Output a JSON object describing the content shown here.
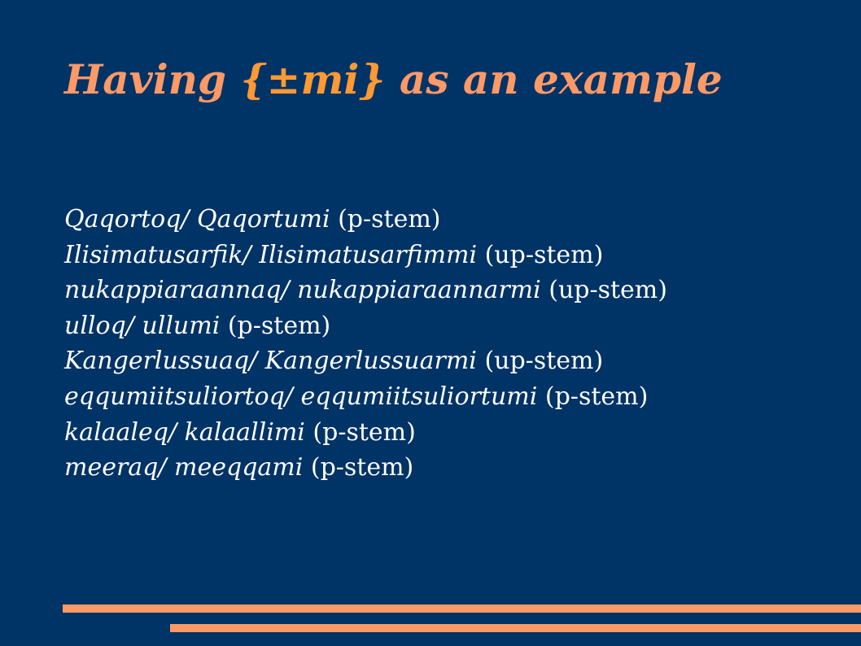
{
  "slide": {
    "title": {
      "before": "Having ",
      "highlight": "{±mi}",
      "after": " as an example"
    },
    "lines": [
      {
        "example": "Qaqortoq/ Qaqortumi",
        "stem": " (p-stem)"
      },
      {
        "example": "Ilisimatusarfik/ Ilisimatusarfimmi",
        "stem": " (up-stem)"
      },
      {
        "example": "nukappiaraannaq/ nukappiaraannarmi",
        "stem": " (up-stem)"
      },
      {
        "example": "ulloq/ ullumi",
        "stem": " (p-stem)"
      },
      {
        "example": "Kangerlussuaq/ Kangerlussuarmi",
        "stem": " (up-stem)"
      },
      {
        "example": "eqqumiitsuliortoq/ eqqumiitsuliortumi",
        "stem": " (p-stem)"
      },
      {
        "example": "kalaaleq/ kalaallimi",
        "stem": " (p-stem)"
      },
      {
        "example": "meeraq/ meeqqami",
        "stem": " (p-stem)"
      }
    ]
  },
  "colors": {
    "background": "#003366",
    "title": "#ff9966",
    "title_highlight": "#ff9933",
    "body_text": "#ffffff",
    "decor_bars": "#ff9966"
  }
}
